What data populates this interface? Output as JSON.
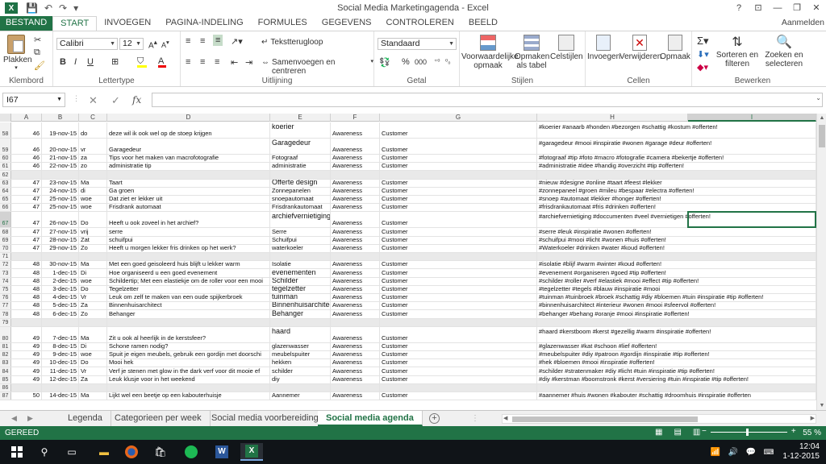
{
  "window": {
    "title": "Social Media Marketingagenda - Excel",
    "controls": [
      "?",
      "⊡",
      "—",
      "❐",
      "✕"
    ]
  },
  "ribbon_tabs": {
    "file": "BESTAND",
    "tabs": [
      "START",
      "INVOEGEN",
      "PAGINA-INDELING",
      "FORMULES",
      "GEGEVENS",
      "CONTROLEREN",
      "BEELD"
    ],
    "active": "START",
    "signin": "Aanmelden"
  },
  "ribbon": {
    "clipboard": {
      "paste": "Plakken",
      "label": "Klembord"
    },
    "font": {
      "name": "Calibri",
      "size": "12",
      "label": "Lettertype"
    },
    "alignment": {
      "wrap": "Tekstterugloop",
      "merge": "Samenvoegen en centreren",
      "label": "Uitlijning"
    },
    "number": {
      "format": "Standaard",
      "label": "Getal"
    },
    "styles": {
      "conditional": "Voorwaardelijke opmaak",
      "as_table": "Opmaken als tabel",
      "cell_styles": "Celstijlen",
      "label": "Stijlen"
    },
    "cells": {
      "insert": "Invoegen",
      "delete": "Verwijderen",
      "format": "Opmaak",
      "label": "Cellen"
    },
    "editing": {
      "sort": "Sorteren en filteren",
      "find": "Zoeken en selecteren",
      "label": "Bewerken"
    }
  },
  "formula_bar": {
    "name_box": "I67",
    "fx": "fx",
    "value": ""
  },
  "columns": [
    "A",
    "B",
    "C",
    "D",
    "E",
    "F",
    "G",
    "H",
    "I"
  ],
  "rows": [
    {
      "n": "58",
      "a": "46",
      "b": "19-nov-15",
      "c": "do",
      "d": "deze wil ik ook wel op de stoep krijgen",
      "e": "koerier",
      "f": "Awareness",
      "g": "Customer",
      "h": "#koerier #anaarb #honden #bezorgen #schattig #kostum #offerten!"
    },
    {
      "n": "59",
      "a": "46",
      "b": "20-nov-15",
      "c": "vr",
      "d": "Garagedeur",
      "e": "Garagedeur",
      "f": "Awareness",
      "g": "Customer",
      "h": "#garagedeur #mooi #inspiratie #wonen #garage #deur #offerten!"
    },
    {
      "n": "60",
      "a": "46",
      "b": "21-nov-15",
      "c": "za",
      "d": "Tips voor het maken van macrofotografie",
      "e": "Fotograaf",
      "f": "Awareness",
      "g": "Customer",
      "h": "#fotograaf #tip #foto #macro #fotografie #camera #bekertje #offerten!"
    },
    {
      "n": "61",
      "a": "46",
      "b": "22-nov-15",
      "c": "zo",
      "d": "administratie tip",
      "e": "administratie",
      "f": "Awareness",
      "g": "Customer",
      "h": "#administratie #idee #handig #overzicht #tip #offerten!"
    },
    {
      "n": "62",
      "a": "",
      "b": "",
      "c": "",
      "d": "",
      "e": "",
      "f": "",
      "g": "",
      "h": ""
    },
    {
      "n": "63",
      "a": "47",
      "b": "23-nov-15",
      "c": "Ma",
      "d": "Taart",
      "e": "Offerte design",
      "f": "Awareness",
      "g": "Customer",
      "h": "#nieuw #designe #online #taart #feest #lekker"
    },
    {
      "n": "64",
      "a": "47",
      "b": "24-nov-15",
      "c": "di",
      "d": "Ga groen",
      "e": "Zonnepanelen",
      "f": "Awareness",
      "g": "Customer",
      "h": "#zonnepaneel #groen #mileu #bespaar #electra #offerten!"
    },
    {
      "n": "65",
      "a": "47",
      "b": "25-nov-15",
      "c": "woe",
      "d": "Dat ziet er lekker uit",
      "e": "snoepautomaat",
      "f": "Awareness",
      "g": "Customer",
      "h": "#snoep #automaat #lekker #honger #offerten!"
    },
    {
      "n": "66",
      "a": "47",
      "b": "25-nov-15",
      "c": "woe",
      "d": "Frisdrank automaat",
      "e": "Frisdrankautomaat",
      "f": "Awareness",
      "g": "Customer",
      "h": "#frisdrankautomaat #fris #drinken #offerten!"
    },
    {
      "n": "67",
      "a": "47",
      "b": "26-nov-15",
      "c": "Do",
      "d": "Heeft u ook zoveel in het archief?",
      "e": "archiefvernietiging",
      "f": "Awareness",
      "g": "Customer",
      "h": "#archiefvernietiging #doccumenten #veel #vernietigen #offerten!"
    },
    {
      "n": "68",
      "a": "47",
      "b": "27-nov-15",
      "c": "vrij",
      "d": "serre",
      "e": "Serre",
      "f": "Awareness",
      "g": "Customer",
      "h": "#serre #leuk #inspiratie #wonen #offerten!"
    },
    {
      "n": "69",
      "a": "47",
      "b": "28-nov-15",
      "c": "Zat",
      "d": "schuifpui",
      "e": "Schuifpui",
      "f": "Awareness",
      "g": "Customer",
      "h": "#schuifpui #mooi #licht #wonen #huis #offerten!"
    },
    {
      "n": "70",
      "a": "47",
      "b": "29-nov-15",
      "c": "Zo",
      "d": "Heeft u morgen lekker fris drinken op het werk?",
      "e": "waterkoeler",
      "f": "Awareness",
      "g": "Customer",
      "h": "#Waterkoeler #drinken #water #koud #offerten!"
    },
    {
      "n": "71",
      "a": "",
      "b": "",
      "c": "",
      "d": "",
      "e": "",
      "f": "",
      "g": "",
      "h": ""
    },
    {
      "n": "72",
      "a": "48",
      "b": "30-nov-15",
      "c": "Ma",
      "d": "Met een goed geisoleerd huis blijft u lekker warm",
      "e": "Isolatie",
      "f": "Awareness",
      "g": "Customer",
      "h": "#isolatie #blijf #warm #winter #koud #offerten!"
    },
    {
      "n": "73",
      "a": "48",
      "b": "1-dec-15",
      "c": "Di",
      "d": "Hoe organiseerd u een goed evenement",
      "e": "evenementen",
      "f": "Awareness",
      "g": "Customer",
      "h": "#evenement #organiseren #goed #tip #offerten!"
    },
    {
      "n": "74",
      "a": "48",
      "b": "2-dec-15",
      "c": "woe",
      "d": "Schildertip; Met een elastiekje om de roller voor een mooi",
      "e": "Schilder",
      "f": "Awareness",
      "g": "Customer",
      "h": "#schilder #roller #verf #elastiek #mooi #effect #tip #offerten!"
    },
    {
      "n": "75",
      "a": "48",
      "b": "3-dec-15",
      "c": "Do",
      "d": "Tegelzetter",
      "e": "tegelzetter",
      "f": "Awareness",
      "g": "Customer",
      "h": "#tegelzetter #tegels #blauw #inspiratie #mooi"
    },
    {
      "n": "76",
      "a": "48",
      "b": "4-dec-15",
      "c": "Vr",
      "d": "Leuk om zelf te maken van een oude spijkerbroek",
      "e": "tuinman",
      "f": "Awareness",
      "g": "Customer",
      "h": "#tuinman #tuinbroek #broek #schattig #diy #bloemen #tuin #inspiratie #tip #offerten!"
    },
    {
      "n": "77",
      "a": "48",
      "b": "5-dec-15",
      "c": "Za",
      "d": "Binnenhuisarchitect",
      "e": "Binnenhuisarchitect",
      "f": "Awareness",
      "g": "Customer",
      "h": "#binnenhuisarchitect #interieur #wonen #mooi #sfeervol #offerten!"
    },
    {
      "n": "78",
      "a": "48",
      "b": "6-dec-15",
      "c": "Zo",
      "d": "Behanger",
      "e": "Behanger",
      "f": "Awareness",
      "g": "Customer",
      "h": "#behanger #behang #oranje #mooi #inspiratie #offerten!"
    },
    {
      "n": "79",
      "a": "",
      "b": "",
      "c": "",
      "d": "",
      "e": "",
      "f": "",
      "g": "",
      "h": ""
    },
    {
      "n": "80",
      "a": "49",
      "b": "7-dec-15",
      "c": "Ma",
      "d": "Zit u ook al heerlijk in de kerstsfeer?",
      "e": "haard",
      "f": "Awareness",
      "g": "Customer",
      "h": "#haard #kerstboom #kerst #gezellig #warm #inspiratie #offerten!"
    },
    {
      "n": "81",
      "a": "49",
      "b": "8-dec-15",
      "c": "Di",
      "d": "Schone ramen nodig?",
      "e": "glazenwasser",
      "f": "Awareness",
      "g": "Customer",
      "h": " #glazenwasser #kat #schoon #lief #offerten!"
    },
    {
      "n": "82",
      "a": "49",
      "b": "9-dec-15",
      "c": "woe",
      "d": "Spuit je eigen meubels, gebruik een gordijn met doorschi",
      "e": "meubelspuiter",
      "f": "Awareness",
      "g": "Customer",
      "h": "#meubelspuiter #diy #patroon #gordijn #inspiratie #tip #offerten!"
    },
    {
      "n": "83",
      "a": "49",
      "b": "10-dec-15",
      "c": "Do",
      "d": "Mooi hek",
      "e": "hekken",
      "f": "Awareness",
      "g": "Customer",
      "h": "#hek #bloemen #mooi #inspiratie #offerten!"
    },
    {
      "n": "84",
      "a": "49",
      "b": "11-dec-15",
      "c": "Vr",
      "d": "Verf je stenen met glow in the dark verf voor dit mooie ef",
      "e": "schilder",
      "f": "Awareness",
      "g": "Customer",
      "h": "#schilder #stratenmaker #diy #licht #tuin #inspiratie #tip #offerten!"
    },
    {
      "n": "85",
      "a": "49",
      "b": "12-dec-15",
      "c": "Za",
      "d": "Leuk klusje voor in het weekend",
      "e": "diy",
      "f": "Awareness",
      "g": "Customer",
      "h": "#diy #kerstman #boomstronk #kerst #versiering #tuin #inspiratie #tip #offerten!"
    },
    {
      "n": "86",
      "a": "",
      "b": "",
      "c": "",
      "d": "",
      "e": "",
      "f": "",
      "g": "",
      "h": ""
    },
    {
      "n": "87",
      "a": "50",
      "b": "14-dec-15",
      "c": "Ma",
      "d": "Lijkt wel een beetje op een kabouterhuisje",
      "e": "Aannemer",
      "f": "Awareness",
      "g": "Customer",
      "h": "#aannemer #huis #wonen #kabouter #schattig #droomhuis #inspiratie #offerten"
    }
  ],
  "sheets": {
    "tabs": [
      "Legenda",
      "Categorieen per week",
      "Social media voorbereiding",
      "Social media agenda"
    ],
    "active": "Social media agenda"
  },
  "status": {
    "ready": "GEREED",
    "zoom": "55 %"
  },
  "taskbar": {
    "time": "12:04",
    "date": "1-12-2015"
  }
}
